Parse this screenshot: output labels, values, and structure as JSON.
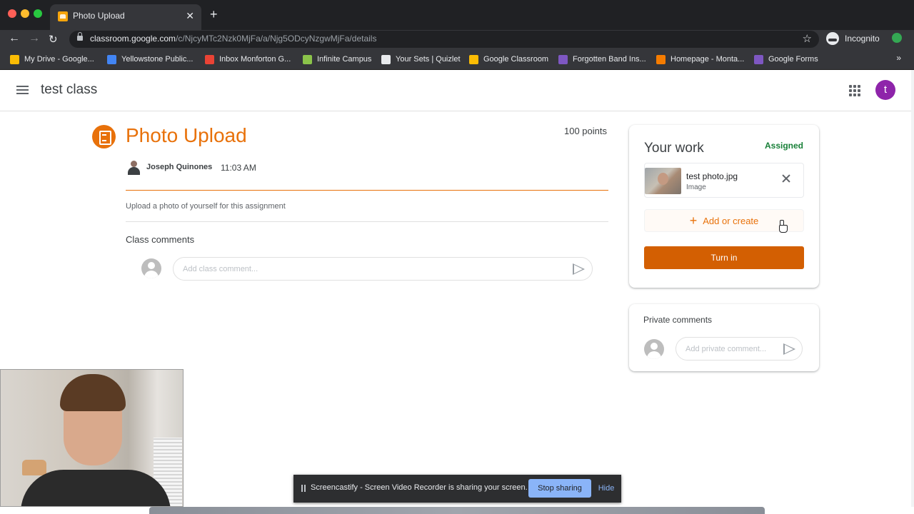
{
  "browser": {
    "tab_title": "Photo Upload",
    "tab_close": "✕",
    "new_tab": "+",
    "url_host": "classroom.google.com",
    "url_path": "/c/NjcyMTc2Nzk0MjFa/a/Njg5ODcyNzgwMjFa/details",
    "incognito_label": "Incognito",
    "bookmarks": [
      {
        "label": "My Drive - Google...",
        "color": "#fbbc04"
      },
      {
        "label": "Yellowstone Public...",
        "color": "#4285f4"
      },
      {
        "label": "Inbox Monforton G...",
        "color": "#ea4335"
      },
      {
        "label": "Infinite Campus",
        "color": "#8bc34a"
      },
      {
        "label": "Your Sets | Quizlet",
        "color": "#e8eaed"
      },
      {
        "label": "Google Classroom",
        "color": "#fbbc04"
      },
      {
        "label": "Forgotten Band Ins...",
        "color": "#7e57c2"
      },
      {
        "label": "Homepage - Monta...",
        "color": "#f57c00"
      },
      {
        "label": "Google Forms",
        "color": "#7e57c2"
      }
    ],
    "bookmarks_more": "»"
  },
  "app": {
    "class_name": "test class",
    "avatar_letter": "t",
    "avatar_color": "#8e24aa"
  },
  "assignment": {
    "title": "Photo Upload",
    "points": "100 points",
    "author": "Joseph Quinones",
    "time": "11:03 AM",
    "instructions": "Upload a photo of yourself for this assignment",
    "accent_color": "#e8710a"
  },
  "class_comments": {
    "heading": "Class comments",
    "placeholder": "Add class comment..."
  },
  "your_work": {
    "title": "Your work",
    "status": "Assigned",
    "attachment": {
      "name": "test photo.jpg",
      "type": "Image"
    },
    "add_or_create": "Add or create",
    "add_plus": "+",
    "turn_in": "Turn in"
  },
  "private_comments": {
    "heading": "Private comments",
    "placeholder": "Add private comment..."
  },
  "screencast": {
    "message": "Screencastify - Screen Video Recorder is sharing your screen.",
    "stop_label": "Stop sharing",
    "hide_label": "Hide"
  }
}
